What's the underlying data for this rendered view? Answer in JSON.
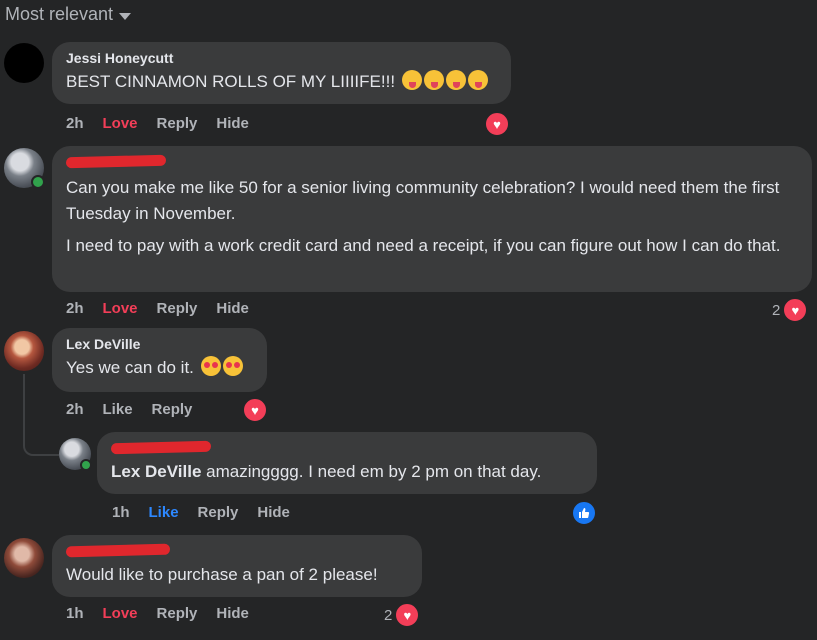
{
  "sort_label": "Most relevant",
  "icons": {
    "sort_caret": "chevron-down-icon",
    "heart": "heart-reaction-icon",
    "like": "thumbs-up-reaction-icon",
    "emoji_tongue": "face-with-tongue-emoji",
    "emoji_love": "smiling-face-with-hearts-emoji"
  },
  "colors": {
    "background": "#242526",
    "bubble": "#3a3b3c",
    "love": "#f33e58",
    "like": "#2d88ff",
    "redaction": "#e0272d",
    "online": "#31a24c"
  },
  "comments": [
    {
      "author": "Jessi Honeycutt",
      "text": "BEST CINNAMON ROLLS OF MY LIIIIFE!!!",
      "time": "2h",
      "reaction_action": "Love",
      "reply": "Reply",
      "hide": "Hide"
    },
    {
      "author": "",
      "paragraphs": [
        "Can you make me like 50 for a senior living community celebration? I would need them the first Tuesday in November.",
        "I need to pay with a work credit card and need a receipt, if you can figure out how I can do that."
      ],
      "time": "2h",
      "reaction_action": "Love",
      "reply": "Reply",
      "hide": "Hide",
      "reaction_count": "2"
    },
    {
      "author": "Lex DeVille",
      "text": "Yes we can do it.",
      "time": "2h",
      "reaction_action": "Like",
      "reply": "Reply"
    },
    {
      "author": "",
      "mention": "Lex DeVille",
      "text": " amazingggg. I need em by 2 pm on that day.",
      "time": "1h",
      "reaction_action": "Like",
      "reply": "Reply",
      "hide": "Hide"
    },
    {
      "author": "",
      "text": "Would like to purchase a pan of 2 please!",
      "time": "1h",
      "reaction_action": "Love",
      "reply": "Reply",
      "hide": "Hide",
      "reaction_count": "2"
    }
  ]
}
